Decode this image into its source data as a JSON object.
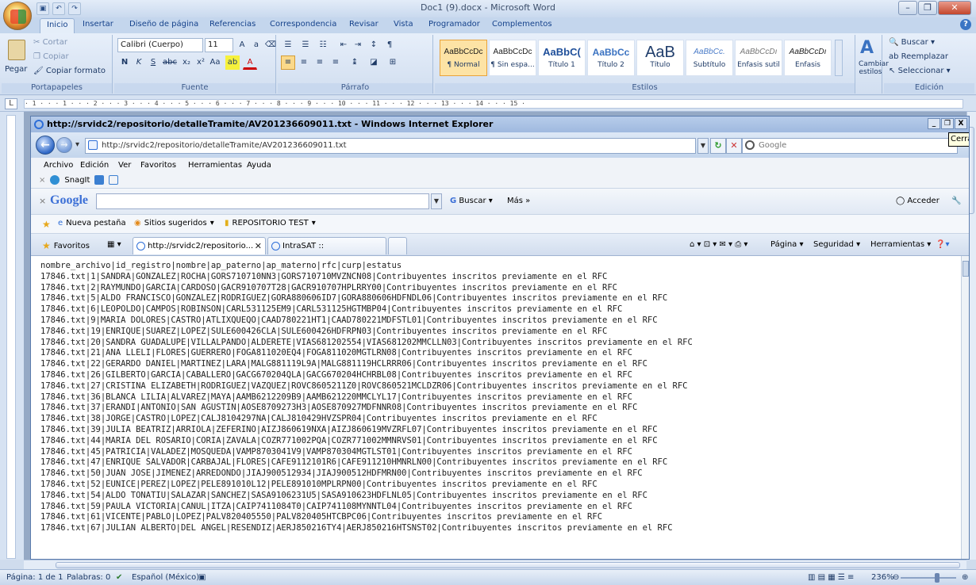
{
  "word": {
    "title": "Doc1 (9).docx - Microsoft Word",
    "tabs": [
      "Inicio",
      "Insertar",
      "Diseño de página",
      "Referencias",
      "Correspondencia",
      "Revisar",
      "Vista",
      "Programador",
      "Complementos"
    ],
    "clipboard": {
      "paste": "Pegar",
      "cut": "Cortar",
      "copy": "Copiar",
      "format": "Copiar formato",
      "label": "Portapapeles"
    },
    "font": {
      "name": "Calibri (Cuerpo)",
      "size": "11",
      "label": "Fuente"
    },
    "paragraph_label": "Párrafo",
    "styles": [
      {
        "sample": "AaBbCcDc",
        "name": "¶ Normal"
      },
      {
        "sample": "AaBbCcDc",
        "name": "¶ Sin espa..."
      },
      {
        "sample": "AaBbC(",
        "name": "Título 1"
      },
      {
        "sample": "AaBbCc",
        "name": "Título 2"
      },
      {
        "sample": "AaB",
        "name": "Título"
      },
      {
        "sample": "AaBbCc.",
        "name": "Subtítulo"
      },
      {
        "sample": "AaBbCcDı",
        "name": "Énfasis sutil"
      },
      {
        "sample": "AaBbCcDı",
        "name": "Énfasis"
      }
    ],
    "styles_label": "Estilos",
    "change_styles": "Cambiar estilos",
    "editing": {
      "find": "Buscar",
      "replace": "Reemplazar",
      "select": "Seleccionar",
      "label": "Edición"
    },
    "ruler": "· 1 · · · 1 · · · 2 · · · 3 · · · 4 · · · 5 · · · 6 · · · 7 · · · 8 · · · 9 · · · 10 · · · 11 · · · 12 · · · 13 · · · 14 · · · 15 ·",
    "status": {
      "page": "Página: 1 de 1",
      "words": "Palabras: 0",
      "lang": "Español (México)",
      "zoom": "236%"
    }
  },
  "ie": {
    "title": "http://srvidc2/repositorio/detalleTramite/AV201236609011.txt - Windows Internet Explorer",
    "url": "http://srvidc2/repositorio/detalleTramite/AV201236609011.txt",
    "search_placeholder": "Google",
    "tooltip": "Cerra",
    "menu": [
      "Archivo",
      "Edición",
      "Ver",
      "Favoritos",
      "Herramientas",
      "Ayuda"
    ],
    "snagit": "SnagIt",
    "google": {
      "logo": "Google",
      "search": "Buscar",
      "more": "Más »",
      "signin": "Acceder"
    },
    "favorites_bar": {
      "new_tab": "Nueva pestaña",
      "suggested": "Sitios sugeridos",
      "repo": "REPOSITORIO TEST"
    },
    "favorites": "Favoritos",
    "tabs": [
      "http://srvidc2/repositorio...",
      "IntraSAT ::"
    ],
    "commands": [
      "Página",
      "Seguridad",
      "Herramientas"
    ],
    "lines": [
      "nombre_archivo|id_registro|nombre|ap_paterno|ap_materno|rfc|curp|estatus",
      "17846.txt|1|SANDRA|GONZALEZ|ROCHA|GORS710710NN3|GORS710710MVZNCN08|Contribuyentes inscritos previamente en el RFC",
      "17846.txt|2|RAYMUNDO|GARCIA|CARDOSO|GACR910707T28|GACR910707HPLRRY00|Contribuyentes inscritos previamente en el RFC",
      "17846.txt|5|ALDO FRANCISCO|GONZALEZ|RODRIGUEZ|GORA880606ID7|GORA880606HDFNDL06|Contribuyentes inscritos previamente en el RFC",
      "17846.txt|6|LEOPOLDO|CAMPOS|ROBINSON|CARL531125EM9|CARL531125HGTMBP04|Contribuyentes inscritos previamente en el RFC",
      "17846.txt|9|MARIA DOLORES|CASTRO|ATLIXQUEQO|CAAD780221HT1|CAAD780221MDFSTL01|Contribuyentes inscritos previamente en el RFC",
      "17846.txt|19|ENRIQUE|SUAREZ|LOPEZ|SULE600426CLA|SULE600426HDFRPN03|Contribuyentes inscritos previamente en el RFC",
      "17846.txt|20|SANDRA GUADALUPE|VILLALPANDO|ALDERETE|VIAS681202554|VIAS681202MMCLLN03|Contribuyentes inscritos previamente en el RFC",
      "17846.txt|21|ANA LLELI|FLORES|GUERRERO|FOGA811020EQ4|FOGA811020MGTLRN08|Contribuyentes inscritos previamente en el RFC",
      "17846.txt|22|GERARDO DANIEL|MARTINEZ|LARA|MALG881119L9A|MALG881119HCLRRR06|Contribuyentes inscritos previamente en el RFC",
      "17846.txt|26|GILBERTO|GARCIA|CABALLERO|GACG670204QLA|GACG670204HCHRBL08|Contribuyentes inscritos previamente en el RFC",
      "17846.txt|27|CRISTINA ELIZABETH|RODRIGUEZ|VAZQUEZ|ROVC8605211Z0|ROVC860521MCLDZR06|Contribuyentes inscritos previamente en el RFC",
      "17846.txt|36|BLANCA LILIA|ALVAREZ|MAYA|AAMB6212209B9|AAMB621220MMCLYL17|Contribuyentes inscritos previamente en el RFC",
      "17846.txt|37|ERANDI|ANTONIO|SAN AGUSTIN|AOSE8709273H3|AOSE870927MDFNNR08|Contribuyentes inscritos previamente en el RFC",
      "17846.txt|38|JORGE|CASTRO|LOPEZ|CALJ8104297NA|CALJ810429HVZSPR04|Contribuyentes inscritos previamente en el RFC",
      "17846.txt|39|JULIA BEATRIZ|ARRIOLA|ZEFERINO|AIZJ860619NXA|AIZJ860619MVZRFL07|Contribuyentes inscritos previamente en el RFC",
      "17846.txt|44|MARIA DEL ROSARIO|CORIA|ZAVALA|COZR771002PQA|COZR771002MMNRVS01|Contribuyentes inscritos previamente en el RFC",
      "17846.txt|45|PATRICIA|VALADEZ|MOSQUEDA|VAMP8703041V9|VAMP870304MGTLST01|Contribuyentes inscritos previamente en el RFC",
      "17846.txt|47|ENRIQUE SALVADOR|CARBAJAL|FLORES|CAFE9112101R6|CAFE911210HMNRLN00|Contribuyentes inscritos previamente en el RFC",
      "17846.txt|50|JUAN JOSE|JIMENEZ|ARREDONDO|JIAJ900512934|JIAJ900512HDFMRN00|Contribuyentes inscritos previamente en el RFC",
      "17846.txt|52|EUNICE|PEREZ|LOPEZ|PELE891010L12|PELE891010MPLRPN00|Contribuyentes inscritos previamente en el RFC",
      "17846.txt|54|ALDO TONATIU|SALAZAR|SANCHEZ|SASA9106231U5|SASA910623HDFLNL05|Contribuyentes inscritos previamente en el RFC",
      "17846.txt|59|PAULA VICTORIA|CANUL|ITZA|CAIP7411084T0|CAIP741108MYNNTL04|Contribuyentes inscritos previamente en el RFC",
      "17846.txt|61|VICENTE|PABLO|LOPEZ|PALV820405550|PALV820405HTCBPC06|Contribuyentes inscritos previamente en el RFC",
      "17846.txt|67|JULIAN ALBERTO|DEL ANGEL|RESENDIZ|AERJ850216TY4|AERJ850216HTSNST02|Contribuyentes inscritos previamente en el RFC"
    ]
  }
}
